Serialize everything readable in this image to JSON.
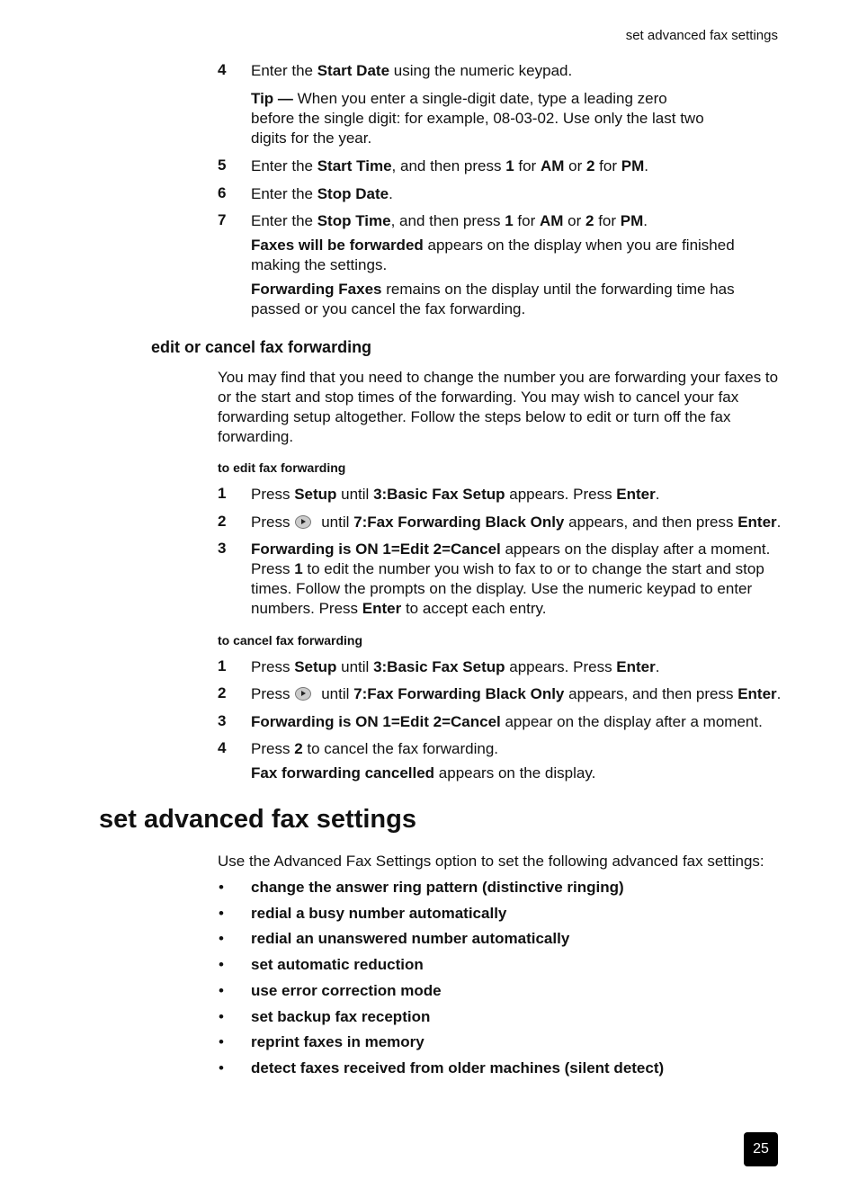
{
  "running_head": "set advanced fax settings",
  "steps_top": [
    {
      "num": "4",
      "parts": [
        [
          "Enter the ",
          0
        ],
        [
          "Start Date",
          1
        ],
        [
          " using the numeric keypad.",
          0
        ]
      ]
    },
    {
      "tip": [
        [
          "Tip —",
          1
        ],
        [
          " When you enter a single-digit date, type a leading zero before the single digit: for example, 08-03-02. Use only the last two digits for the year.",
          0
        ]
      ]
    },
    {
      "num": "5",
      "parts": [
        [
          "Enter the ",
          0
        ],
        [
          "Start Time",
          1
        ],
        [
          ", and then press ",
          0
        ],
        [
          "1",
          1
        ],
        [
          " for ",
          0
        ],
        [
          "AM",
          1
        ],
        [
          " or ",
          0
        ],
        [
          "2",
          1
        ],
        [
          " for ",
          0
        ],
        [
          "PM",
          1
        ],
        [
          ".",
          0
        ]
      ]
    },
    {
      "num": "6",
      "parts": [
        [
          "Enter the ",
          0
        ],
        [
          "Stop Date",
          1
        ],
        [
          ".",
          0
        ]
      ]
    },
    {
      "num": "7",
      "parts": [
        [
          "Enter the ",
          0
        ],
        [
          "Stop Time",
          1
        ],
        [
          ", and then press ",
          0
        ],
        [
          "1",
          1
        ],
        [
          " for ",
          0
        ],
        [
          "AM",
          1
        ],
        [
          " or ",
          0
        ],
        [
          "2",
          1
        ],
        [
          " for ",
          0
        ],
        [
          "PM",
          1
        ],
        [
          ".",
          0
        ]
      ]
    }
  ],
  "note1": [
    [
      "Faxes will be forwarded",
      1
    ],
    [
      " appears on the display when you are finished making the settings.",
      0
    ]
  ],
  "note2": [
    [
      "Forwarding Faxes",
      1
    ],
    [
      " remains on the display until the forwarding time has passed or you cancel the fax forwarding.",
      0
    ]
  ],
  "section_edit": {
    "heading": "edit or cancel fax forwarding",
    "intro": "You may find that you need to change the number you are forwarding your faxes to or the start and stop times of the forwarding. You may wish to cancel your fax forwarding setup altogether. Follow the steps below to edit or turn off the fax forwarding.",
    "edit_heading": "to edit fax forwarding",
    "edit_steps": [
      {
        "num": "1",
        "parts": [
          [
            "Press ",
            0
          ],
          [
            "Setup",
            1
          ],
          [
            " until ",
            0
          ],
          [
            "3:Basic Fax Setup",
            1
          ],
          [
            " appears. Press ",
            0
          ],
          [
            "Enter",
            1
          ],
          [
            ".",
            0
          ]
        ]
      },
      {
        "num": "2",
        "icon": true,
        "pre": "Press",
        "parts": [
          [
            " until ",
            0
          ],
          [
            "7:Fax Forwarding Black Only",
            1
          ],
          [
            " appears, and then press ",
            0
          ],
          [
            "Enter",
            1
          ],
          [
            ".",
            0
          ]
        ]
      },
      {
        "num": "3",
        "parts": [
          [
            "Forwarding is ON 1=Edit 2=Cancel",
            1
          ],
          [
            " appears on the display after a moment. Press ",
            0
          ],
          [
            "1",
            1
          ],
          [
            " to edit the number you wish to fax to or to change the start and stop times. Follow the prompts on the display. Use the numeric keypad to enter numbers. Press ",
            0
          ],
          [
            "Enter",
            1
          ],
          [
            " to accept each entry.",
            0
          ]
        ]
      }
    ],
    "cancel_heading": "to cancel fax forwarding",
    "cancel_steps": [
      {
        "num": "1",
        "parts": [
          [
            "Press ",
            0
          ],
          [
            "Setup",
            1
          ],
          [
            " until ",
            0
          ],
          [
            "3:Basic Fax Setup",
            1
          ],
          [
            " appears. Press ",
            0
          ],
          [
            "Enter",
            1
          ],
          [
            ".",
            0
          ]
        ]
      },
      {
        "num": "2",
        "icon": true,
        "pre": "Press",
        "parts": [
          [
            " until ",
            0
          ],
          [
            "7:Fax Forwarding Black Only",
            1
          ],
          [
            " appears, and then press ",
            0
          ],
          [
            "Enter",
            1
          ],
          [
            ".",
            0
          ]
        ]
      },
      {
        "num": "3",
        "parts": [
          [
            "Forwarding is ON 1=Edit 2=Cancel",
            1
          ],
          [
            " appear on the display after a moment.",
            0
          ]
        ]
      },
      {
        "num": "4",
        "parts": [
          [
            "Press ",
            0
          ],
          [
            "2",
            1
          ],
          [
            " to cancel the fax forwarding.",
            0
          ]
        ]
      }
    ],
    "cancel_note": [
      [
        "Fax forwarding cancelled",
        1
      ],
      [
        " appears on the display.",
        0
      ]
    ]
  },
  "section_advanced": {
    "heading": "set advanced fax settings",
    "intro": "Use the Advanced Fax Settings option to set the following advanced fax settings:",
    "bullets": [
      "change the answer ring pattern (distinctive ringing)",
      "redial a busy number automatically",
      "redial an unanswered number automatically",
      "set automatic reduction",
      "use error correction mode",
      "set backup fax reception",
      "reprint faxes in memory",
      "detect faxes received from older machines (silent detect)"
    ]
  },
  "page_number": "25"
}
